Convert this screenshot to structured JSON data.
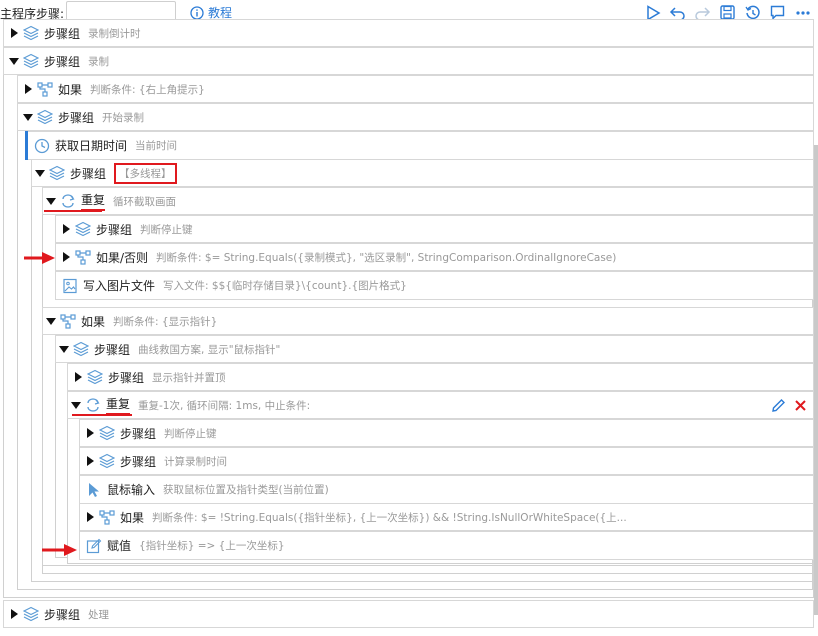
{
  "toolbar": {
    "label": "主程序步骤:",
    "input_value": "",
    "tutorial": "教程"
  },
  "rows": [
    {
      "title": "步骤组",
      "desc": "录制倒计时"
    },
    {
      "title": "步骤组",
      "desc": "录制"
    },
    {
      "title": "如果",
      "desc": "判断条件: {右上角提示}"
    },
    {
      "title": "步骤组",
      "desc": "开始录制"
    },
    {
      "title": "获取日期时间",
      "desc": "当前时间"
    },
    {
      "title": "步骤组",
      "desc": "【多线程】"
    },
    {
      "title": "重复",
      "desc": "循环截取画面"
    },
    {
      "title": "步骤组",
      "desc": "判断停止键"
    },
    {
      "title": "如果/否则",
      "desc": "判断条件: $= String.Equals({录制模式}, \"选区录制\", StringComparison.OrdinalIgnoreCase)"
    },
    {
      "title": "写入图片文件",
      "desc": "写入文件: $${临时存储目录}\\{count}.{图片格式}"
    },
    {
      "title": "如果",
      "desc": "判断条件: {显示指针}"
    },
    {
      "title": "步骤组",
      "desc": "曲线救国方案, 显示\"鼠标指针\""
    },
    {
      "title": "步骤组",
      "desc": "显示指针并置顶"
    },
    {
      "title": "重复",
      "desc": "重复-1次, 循环间隔: 1ms, 中止条件:"
    },
    {
      "title": "步骤组",
      "desc": "判断停止键"
    },
    {
      "title": "步骤组",
      "desc": "计算录制时间"
    },
    {
      "title": "鼠标输入",
      "desc": "获取鼠标位置及指针类型(当前位置)"
    },
    {
      "title": "如果",
      "desc": "判断条件: $= !String.Equals({指针坐标}, {上一次坐标}) && !String.IsNullOrWhiteSpace({上..."
    },
    {
      "title": "赋值",
      "desc": "{指针坐标} => {上一次坐标}"
    },
    {
      "title": "步骤组",
      "desc": "处理"
    }
  ],
  "colors": {
    "accent": "#2b7bd6",
    "highlight": "#e0191e",
    "icon_blue": "#5b9bd5"
  }
}
